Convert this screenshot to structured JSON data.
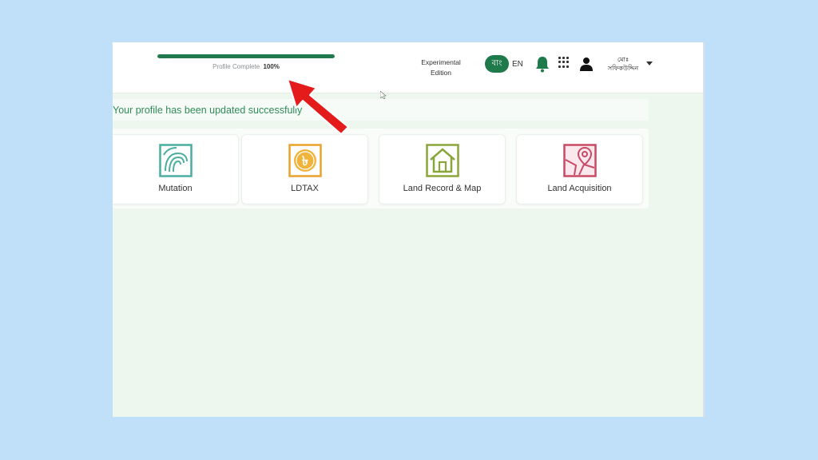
{
  "header": {
    "profile_progress": {
      "label": "Profile Complete",
      "value_text": "100%",
      "value": 100
    },
    "edition": {
      "line1": "Experimental",
      "line2": "Edition"
    },
    "language": {
      "bn": "বাং",
      "en": "EN"
    },
    "user": {
      "line1": "মোঃ",
      "line2": "সফিকউদ্দিন"
    },
    "icons": [
      "bell-icon",
      "apps-grid-icon",
      "user-icon",
      "caret-down-icon"
    ]
  },
  "banner": {
    "message": "Your profile has been updated successfully"
  },
  "services": [
    {
      "label": "Mutation",
      "icon": "fingerprint-icon",
      "color": "#4aaea0"
    },
    {
      "label": "LDTAX",
      "icon": "taka-coin-icon",
      "color": "#e9a22b"
    },
    {
      "label": "Land Record & Map",
      "icon": "house-icon",
      "color": "#8aa53a"
    },
    {
      "label": "Land Acquisition",
      "icon": "map-pin-icon",
      "color": "#c94a67"
    }
  ],
  "colors": {
    "brand_green": "#1e7a4a",
    "page_bg": "#eef7ee",
    "arrow": "#e31b1b"
  }
}
